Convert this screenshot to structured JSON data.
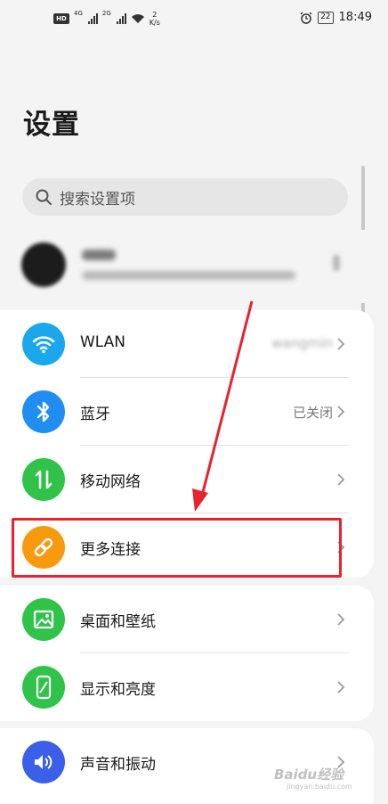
{
  "status_bar": {
    "hd": "HD",
    "net1": "4G",
    "net2": "2G",
    "speed_value": "2",
    "speed_unit": "K/s",
    "battery": "22",
    "time": "18:49"
  },
  "page_title": "设置",
  "search": {
    "placeholder": "搜索设置项"
  },
  "account": {
    "name": "帐田",
    "subtitle": "华为帐号、付款与账单、云空间等"
  },
  "network_rows": [
    {
      "label": "WLAN",
      "value": "wangmin",
      "icon": "wifi-icon",
      "color": "#1aa7ec"
    },
    {
      "label": "蓝牙",
      "value": "已关闭",
      "icon": "bluetooth-icon",
      "color": "#1f8ef0"
    },
    {
      "label": "移动网络",
      "value": "",
      "icon": "mobile-data-icon",
      "color": "#2fc34a"
    },
    {
      "label": "更多连接",
      "value": "",
      "icon": "link-icon",
      "color": "#f79a10"
    }
  ],
  "display_rows": [
    {
      "label": "桌面和壁纸",
      "icon": "wallpaper-icon",
      "color": "#2fc34a"
    },
    {
      "label": "显示和亮度",
      "icon": "display-icon",
      "color": "#2fc34a"
    }
  ],
  "sound_rows": [
    {
      "label": "声音和振动",
      "icon": "speaker-icon",
      "color": "#3b5fe8"
    }
  ],
  "annotation": {
    "color": "#e8232b"
  },
  "watermark": {
    "text": "Baidu经验",
    "sub": "jingyan.baidu.com"
  }
}
